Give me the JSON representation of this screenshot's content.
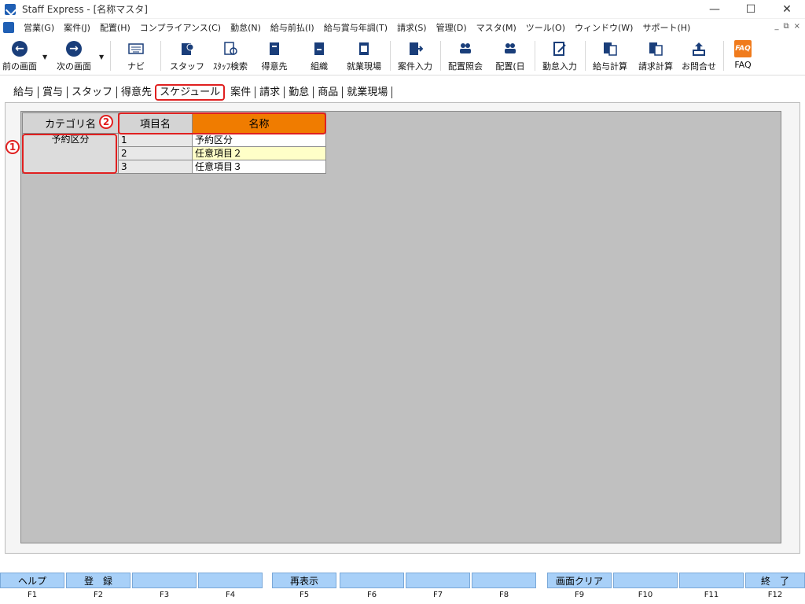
{
  "window": {
    "title": "Staff Express - [名称マスタ]",
    "minimize": "—",
    "maximize": "☐",
    "close": "✕"
  },
  "menu": {
    "items": [
      "営業(G)",
      "案件(J)",
      "配置(H)",
      "コンプライアンス(C)",
      "勤怠(N)",
      "給与前払(I)",
      "給与賞与年調(T)",
      "請求(S)",
      "管理(D)",
      "マスタ(M)",
      "ツール(O)",
      "ウィンドウ(W)",
      "サポート(H)"
    ],
    "mdi_min": "_",
    "mdi_restore": "⧉",
    "mdi_close": "×"
  },
  "toolbar": {
    "back": "前の画面",
    "forward": "次の画面",
    "navi": "ナビ",
    "staff": "スタッフ",
    "staff_search": "ｽﾀｯﾌ検索",
    "client": "得意先",
    "org": "組織",
    "worksite": "就業現場",
    "case_input": "案件入力",
    "assign_view": "配置照会",
    "assign_day": "配置(日",
    "attendance_input": "勤怠入力",
    "payroll_calc": "給与計算",
    "billing_calc": "請求計算",
    "inquiry": "お問合せ",
    "faq": "FAQ",
    "faq_icon": "FAQ"
  },
  "tabs": [
    "給与",
    "賞与",
    "スタッフ",
    "得意先",
    "スケジュール",
    "案件",
    "請求",
    "勤怠",
    "商品",
    "就業現場"
  ],
  "selected_tab": "スケジュール",
  "grid": {
    "headers": {
      "category": "カテゴリ名",
      "item": "項目名",
      "name": "名称"
    },
    "category": "予約区分",
    "rows": [
      {
        "code": "1",
        "name": "予約区分"
      },
      {
        "code": "2",
        "name": "任意項目２"
      },
      {
        "code": "3",
        "name": "任意項目３"
      }
    ]
  },
  "annotations": {
    "one": "1",
    "two": "2"
  },
  "fkeys": [
    {
      "label": "ヘルプ",
      "key": "F1"
    },
    {
      "label": "登　録",
      "key": "F2"
    },
    {
      "label": "",
      "key": "F3"
    },
    {
      "label": "",
      "key": "F4"
    },
    {
      "label": "再表示",
      "key": "F5"
    },
    {
      "label": "",
      "key": "F6"
    },
    {
      "label": "",
      "key": "F7"
    },
    {
      "label": "",
      "key": "F8"
    },
    {
      "label": "画面クリア",
      "key": "F9"
    },
    {
      "label": "",
      "key": "F10"
    },
    {
      "label": "",
      "key": "F11"
    },
    {
      "label": "終　了",
      "key": "F12"
    }
  ],
  "colors": {
    "accent_orange": "#f07c00",
    "annotation_red": "#e02020",
    "fkey_blue": "#a8d0f8",
    "grid_gray": "#c0c0c0",
    "highlight_row": "#ffffc8"
  }
}
